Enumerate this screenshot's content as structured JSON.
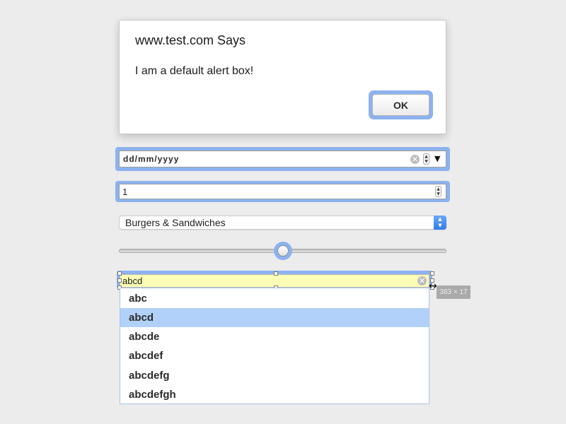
{
  "alert": {
    "title": "www.test.com Says",
    "message": "I am a default alert box!",
    "ok_label": "OK"
  },
  "date_input": {
    "placeholder": "dd/mm/yyyy",
    "clear_icon": "✕",
    "spin_up": "▲",
    "spin_down": "▼",
    "dropdown_icon": "▼"
  },
  "number_input": {
    "value": "1",
    "spin_up": "▲",
    "spin_down": "▼"
  },
  "select": {
    "selected": "Burgers & Sandwiches",
    "arrows_up": "▲",
    "arrows_down": "▼"
  },
  "slider": {
    "value_fraction": 0.5
  },
  "autocomplete": {
    "value": "abcd",
    "clear_icon": "✕",
    "size_label": "383 × 17",
    "resize_cursor": "↔",
    "options": [
      {
        "label": "abc",
        "selected": false
      },
      {
        "label": "abcd",
        "selected": true
      },
      {
        "label": "abcde",
        "selected": false
      },
      {
        "label": "abcdef",
        "selected": false
      },
      {
        "label": "abcdefg",
        "selected": false
      },
      {
        "label": "abcdefgh",
        "selected": false
      }
    ]
  },
  "colors": {
    "focus_ring": "#8cb2ef",
    "autofill_bg": "#fbfdb6",
    "selected_option": "#b2d1fa",
    "select_accent": "#2f7bef"
  }
}
